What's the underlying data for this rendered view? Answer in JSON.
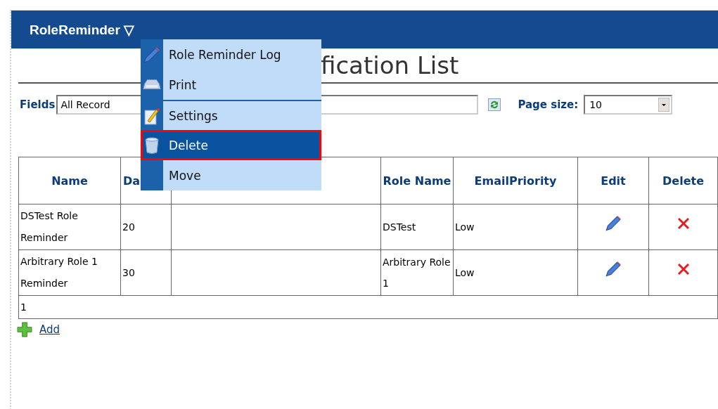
{
  "header": {
    "title": "RoleReminder",
    "menu_caret": "▽"
  },
  "menu": {
    "items": [
      {
        "label": "Role Reminder Log",
        "selected": false
      },
      {
        "label": "Print",
        "selected": false
      },
      {
        "label": "Settings",
        "selected": false
      },
      {
        "label": "Delete",
        "selected": true
      },
      {
        "label": "Move",
        "selected": false
      }
    ]
  },
  "page_title": "fication List",
  "filter": {
    "label": "Fields",
    "value": "All Record"
  },
  "page_size": {
    "label": "Page size:",
    "value": "10"
  },
  "table": {
    "columns": [
      "Name",
      "Da",
      "",
      "Role Name",
      "EmailPriority",
      "Edit",
      "Delete"
    ],
    "rows": [
      {
        "name": "DSTest Role Reminder",
        "days": "20",
        "email_to": "",
        "role_name": "DSTest",
        "priority": "Low"
      },
      {
        "name": "Arbitrary Role 1 Reminder",
        "days": "30",
        "email_to": "",
        "role_name": "Arbitrary Role 1",
        "priority": "Low"
      }
    ],
    "pager": "1"
  },
  "add_link": "Add"
}
